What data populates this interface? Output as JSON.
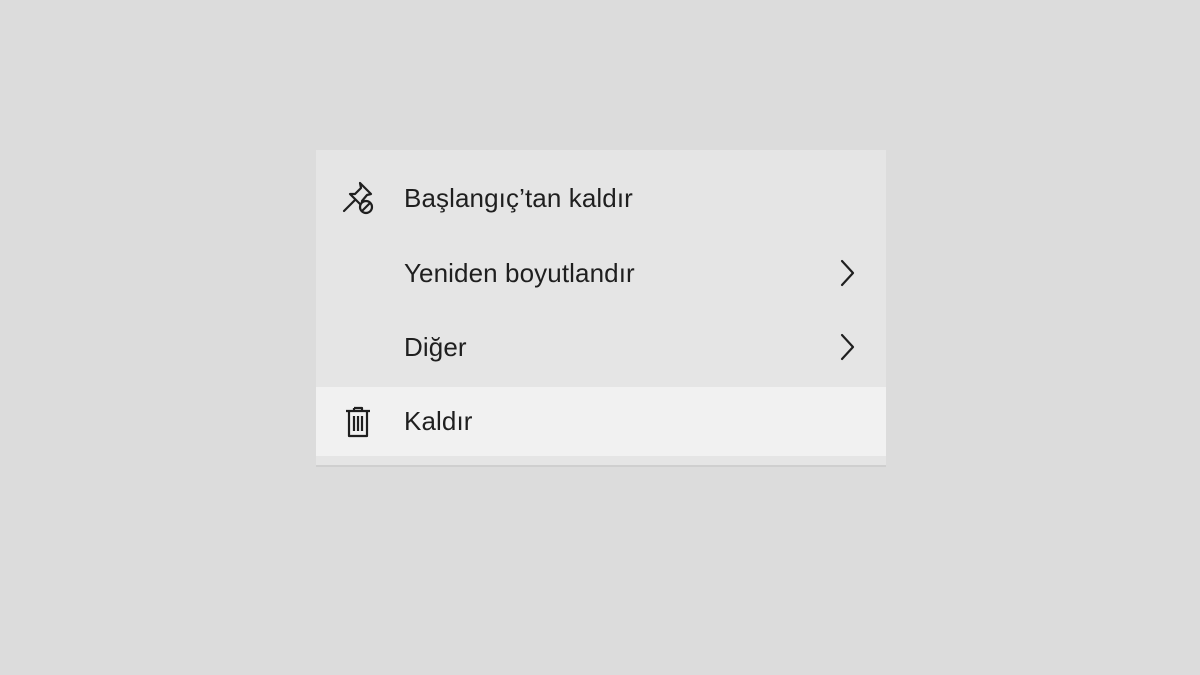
{
  "menu": {
    "items": [
      {
        "label": "Başlangıç’tan kaldır",
        "icon": "unpin-icon",
        "submenu": false
      },
      {
        "label": "Yeniden boyutlandır",
        "icon": "",
        "submenu": true
      },
      {
        "label": "Diğer",
        "icon": "",
        "submenu": true
      },
      {
        "label": "Kaldır",
        "icon": "trash-icon",
        "submenu": false,
        "highlighted": true
      }
    ]
  },
  "colors": {
    "page_background": "#dcdcdc",
    "menu_background": "#e5e5e5",
    "hover_background": "#f1f1f1",
    "text": "#1f1f1f"
  }
}
